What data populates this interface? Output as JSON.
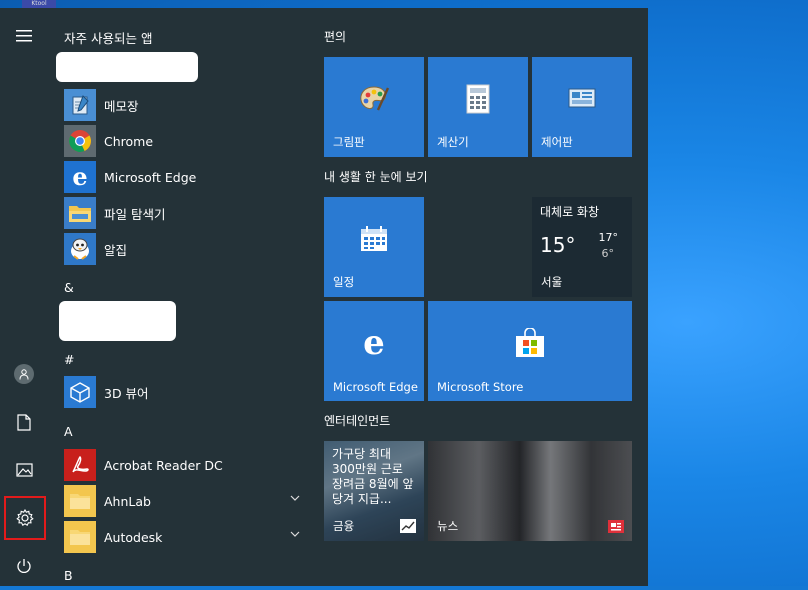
{
  "desktop": {
    "icon_label": "Ktool"
  },
  "rail": {
    "items": [
      {
        "name": "hamburger-menu-icon"
      },
      {
        "name": "user-avatar-icon"
      },
      {
        "name": "documents-icon"
      },
      {
        "name": "pictures-icon"
      },
      {
        "name": "settings-icon",
        "selected": true
      },
      {
        "name": "power-icon"
      }
    ]
  },
  "app_list": {
    "frequent_header": "자주 사용되는 앱",
    "frequent": [
      {
        "name": "메모장",
        "icon": "notepad-icon"
      },
      {
        "name": "Chrome",
        "icon": "chrome-icon"
      },
      {
        "name": "Microsoft Edge",
        "icon": "edge-icon"
      },
      {
        "name": "파일 탐색기",
        "icon": "file-explorer-icon"
      },
      {
        "name": "알집",
        "icon": "alzip-icon"
      }
    ],
    "headers": {
      "amp": "&",
      "hash": "#",
      "a": "A",
      "b": "B"
    },
    "hash_apps": [
      {
        "name": "3D 뷰어",
        "icon": "3d-viewer-icon"
      }
    ],
    "a_apps": [
      {
        "name": "Acrobat Reader DC",
        "icon": "acrobat-icon"
      },
      {
        "name": "AhnLab",
        "icon": "folder-icon",
        "expandable": true
      },
      {
        "name": "Autodesk",
        "icon": "folder-icon",
        "expandable": true
      }
    ]
  },
  "tiles": {
    "groups": {
      "productivity": "편의",
      "life": "내 생활 한 눈에 보기",
      "entertainment": "엔터테인먼트"
    },
    "paint": "그림판",
    "calculator": "계산기",
    "control_panel": "제어판",
    "calendar": "일정",
    "weather": {
      "condition": "대체로 화창",
      "temp": "15°",
      "high": "17°",
      "low": "6°",
      "city": "서울"
    },
    "edge": "Microsoft Edge",
    "store": "Microsoft Store",
    "finance": {
      "headline": "가구당 최대 300만원 근로 장려금 8월에 앞당겨 지급...",
      "label": "금융"
    },
    "news": {
      "label": "뉴스"
    }
  },
  "colors": {
    "start_bg": "#243238",
    "tile_blue": "#2a7ad2",
    "selection_outline": "#e21b1b"
  }
}
